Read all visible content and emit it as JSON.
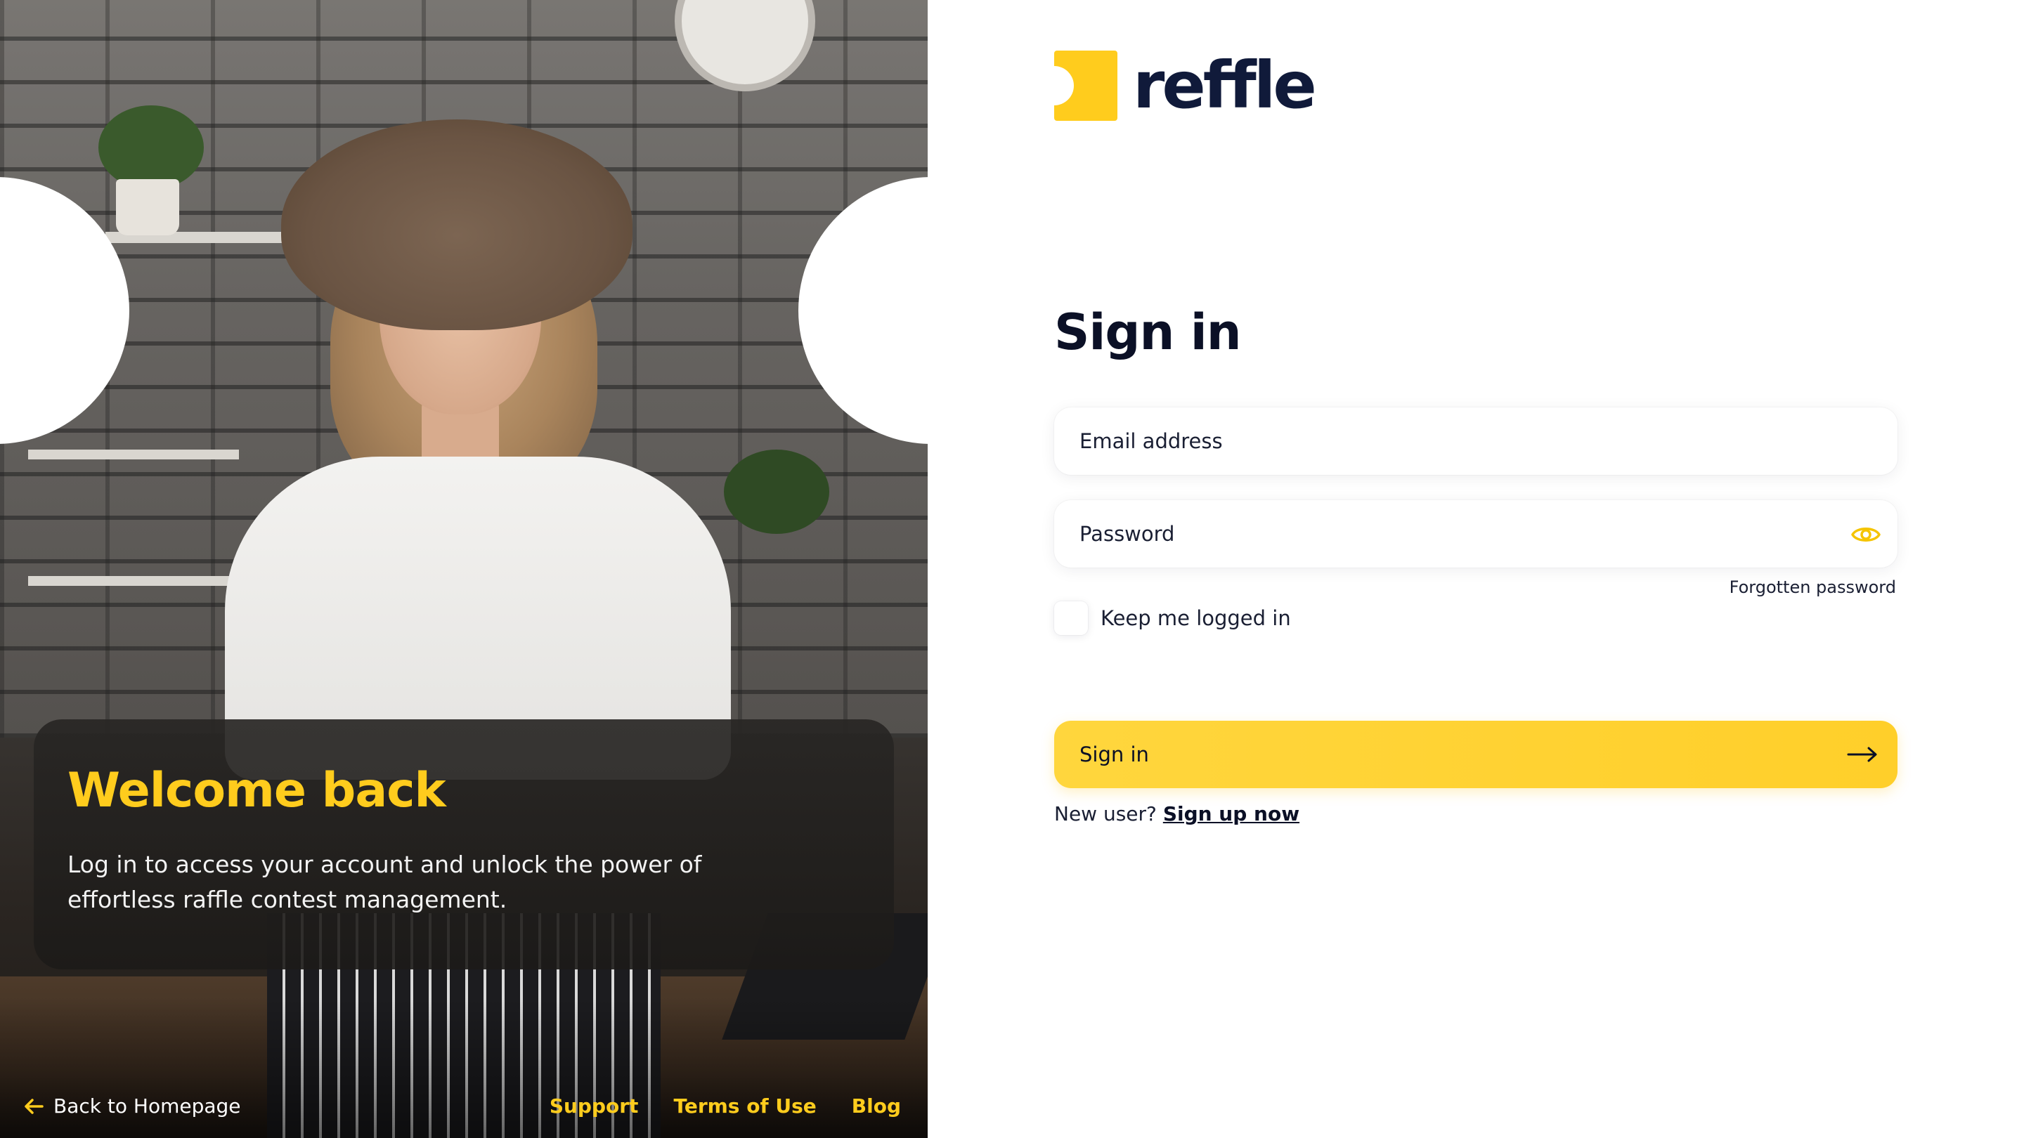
{
  "brand": {
    "name": "reffle",
    "accent_color": "#ffcc1d",
    "text_color": "#101a3a"
  },
  "hero": {
    "welcome_title": "Welcome back",
    "welcome_text": "Log in to access your account and unlock the power of effortless raffle contest management.",
    "back_link": "Back to Homepage",
    "back_icon": "arrow-left-icon",
    "footer_links": [
      "Support",
      "Terms of Use",
      "Blog"
    ]
  },
  "form": {
    "title": "Sign in",
    "email_placeholder": "Email address",
    "password_placeholder": "Password",
    "password_toggle_icon": "eye-icon",
    "forgot_password": "Forgotten password",
    "keep_logged_in": "Keep me logged in",
    "submit_label": "Sign in",
    "submit_icon": "arrow-right-icon",
    "new_user_text": "New user?",
    "signup_link": "Sign up now"
  }
}
